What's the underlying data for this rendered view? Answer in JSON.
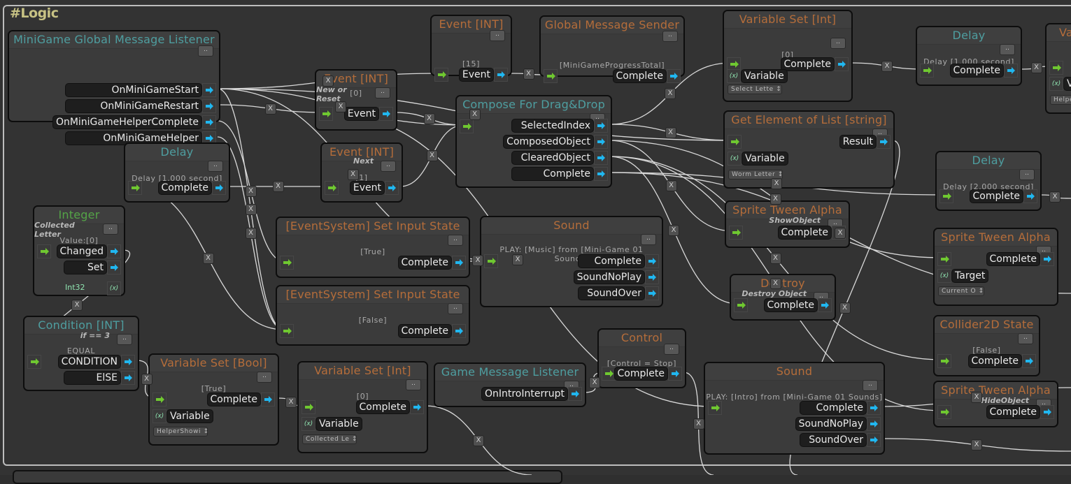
{
  "group": {
    "title": "#Logic"
  },
  "colors": {
    "wire": "#d9d9d9",
    "in_port": "#6fc830",
    "out_port": "#20b7f0",
    "title_orange": "#b56d3a",
    "title_teal": "#4e9ea0",
    "title_green": "#54a447",
    "group_title": "#c7c284"
  },
  "icons": {
    "in_port": "green-arrow-icon",
    "out_port": "blue-arrow-icon",
    "variable": "variable-x-icon",
    "menu": "ellipsis-icon",
    "delete_link": "x-icon"
  },
  "menu_label": "..",
  "delete_label": "X",
  "variable_icon_label": "(x)",
  "nodes": {
    "mgListener": {
      "title": "MiniGame Global Message Listener",
      "outputs": [
        "OnMiniGameStart",
        "OnMiniGameRestart",
        "OnMiniGameHelperComplete",
        "OnMiniGameHelper"
      ]
    },
    "event15": {
      "title": "Event [INT]",
      "info": "[15]",
      "outputs": [
        "Event"
      ]
    },
    "globalSender": {
      "title": "Global Message Sender",
      "info": "[MiniGameProgressTotal]",
      "outputs": [
        "Complete"
      ]
    },
    "varSetInt1": {
      "title": "Variable Set [Int]",
      "info": "[0]",
      "outputs": [
        "Complete"
      ],
      "variable": "Variable",
      "select": "Select Lette ↕"
    },
    "delay1r": {
      "title": "Delay",
      "info": "Delay [1.000 second]",
      "outputs": [
        "Complete"
      ]
    },
    "varCut": {
      "title": "Va",
      "variable": "Va",
      "select": "Helpe"
    },
    "eventNew": {
      "title": "Event [INT]",
      "subtitle": "New or Reset",
      "info": "[0]",
      "outputs": [
        "Event"
      ]
    },
    "compose": {
      "title": "Compose For Drag&Drop",
      "outputs": [
        "SelectedIndex",
        "ComposedObject",
        "ClearedObject",
        "Complete"
      ]
    },
    "getElem": {
      "title": "Get Element of List [string]",
      "outputs": [
        "Result"
      ],
      "variable": "Variable",
      "select": "Worm Letter ↕"
    },
    "delayL": {
      "title": "Delay",
      "info": "Delay [1.000 second]",
      "outputs": [
        "Complete"
      ]
    },
    "eventNext": {
      "title": "Event [INT]",
      "subtitle": "Next",
      "info": "[1]",
      "outputs": [
        "Event"
      ]
    },
    "delay2": {
      "title": "Delay",
      "info": "Delay [2.000 second]",
      "outputs": [
        "Complete"
      ]
    },
    "integer": {
      "title": "Integer",
      "subtitle": "Collected Letter",
      "info": "Value:[0]",
      "outputs": [
        "Changed",
        "Set"
      ],
      "type": "Int32"
    },
    "inputTrue": {
      "title": "[EventSystem] Set Input State",
      "info": "[True]",
      "outputs": [
        "Complete"
      ]
    },
    "soundMusic": {
      "title": "Sound",
      "info": "PLAY: [Music] from [Mini-Game 01 Sounds]",
      "outputs": [
        "Complete",
        "SoundNoPlay",
        "SoundOver"
      ]
    },
    "spriteShow": {
      "title": "Sprite Tween Alpha",
      "subtitle": "ShowObject",
      "outputs": [
        "Complete"
      ]
    },
    "spriteTarget": {
      "title": "Sprite Tween Alpha",
      "outputs": [
        "Complete"
      ],
      "variable": "Target",
      "select": "Current O ↕"
    },
    "destroy": {
      "title": "Destroy",
      "subtitle": "Destroy Object",
      "outputs": [
        "Complete"
      ]
    },
    "inputFalse": {
      "title": "[EventSystem] Set Input State",
      "info": "[False]",
      "outputs": [
        "Complete"
      ]
    },
    "condition": {
      "title": "Condition [INT]",
      "subtitle": "if == 3",
      "info": "EQUAL",
      "outputs": [
        "CONDITION",
        "ElSE"
      ]
    },
    "collider": {
      "title": "Collider2D State",
      "info": "[False]",
      "outputs": [
        "Complete"
      ]
    },
    "varSetBool": {
      "title": "Variable Set [Bool]",
      "info": "[True]",
      "outputs": [
        "Complete"
      ],
      "variable": "Variable",
      "select": "HelperShowi ↕"
    },
    "varSetInt2": {
      "title": "Variable Set [Int]",
      "info": "[0]",
      "outputs": [
        "Complete"
      ],
      "variable": "Variable",
      "select": "Collected Le ↕"
    },
    "gameListener": {
      "title": "Game Message Listener",
      "outputs": [
        "OnIntroInterrupt"
      ]
    },
    "control": {
      "title": "Control",
      "info": "[Control = Stop]",
      "outputs": [
        "Complete"
      ]
    },
    "soundIntro": {
      "title": "Sound",
      "info": "PLAY: [Intro] from [Mini-Game 01 Sounds]",
      "outputs": [
        "Complete",
        "SoundNoPlay",
        "SoundOver"
      ]
    },
    "spriteHide": {
      "title": "Sprite Tween Alpha",
      "subtitle": "HideObject",
      "outputs": [
        "Complete"
      ]
    }
  }
}
